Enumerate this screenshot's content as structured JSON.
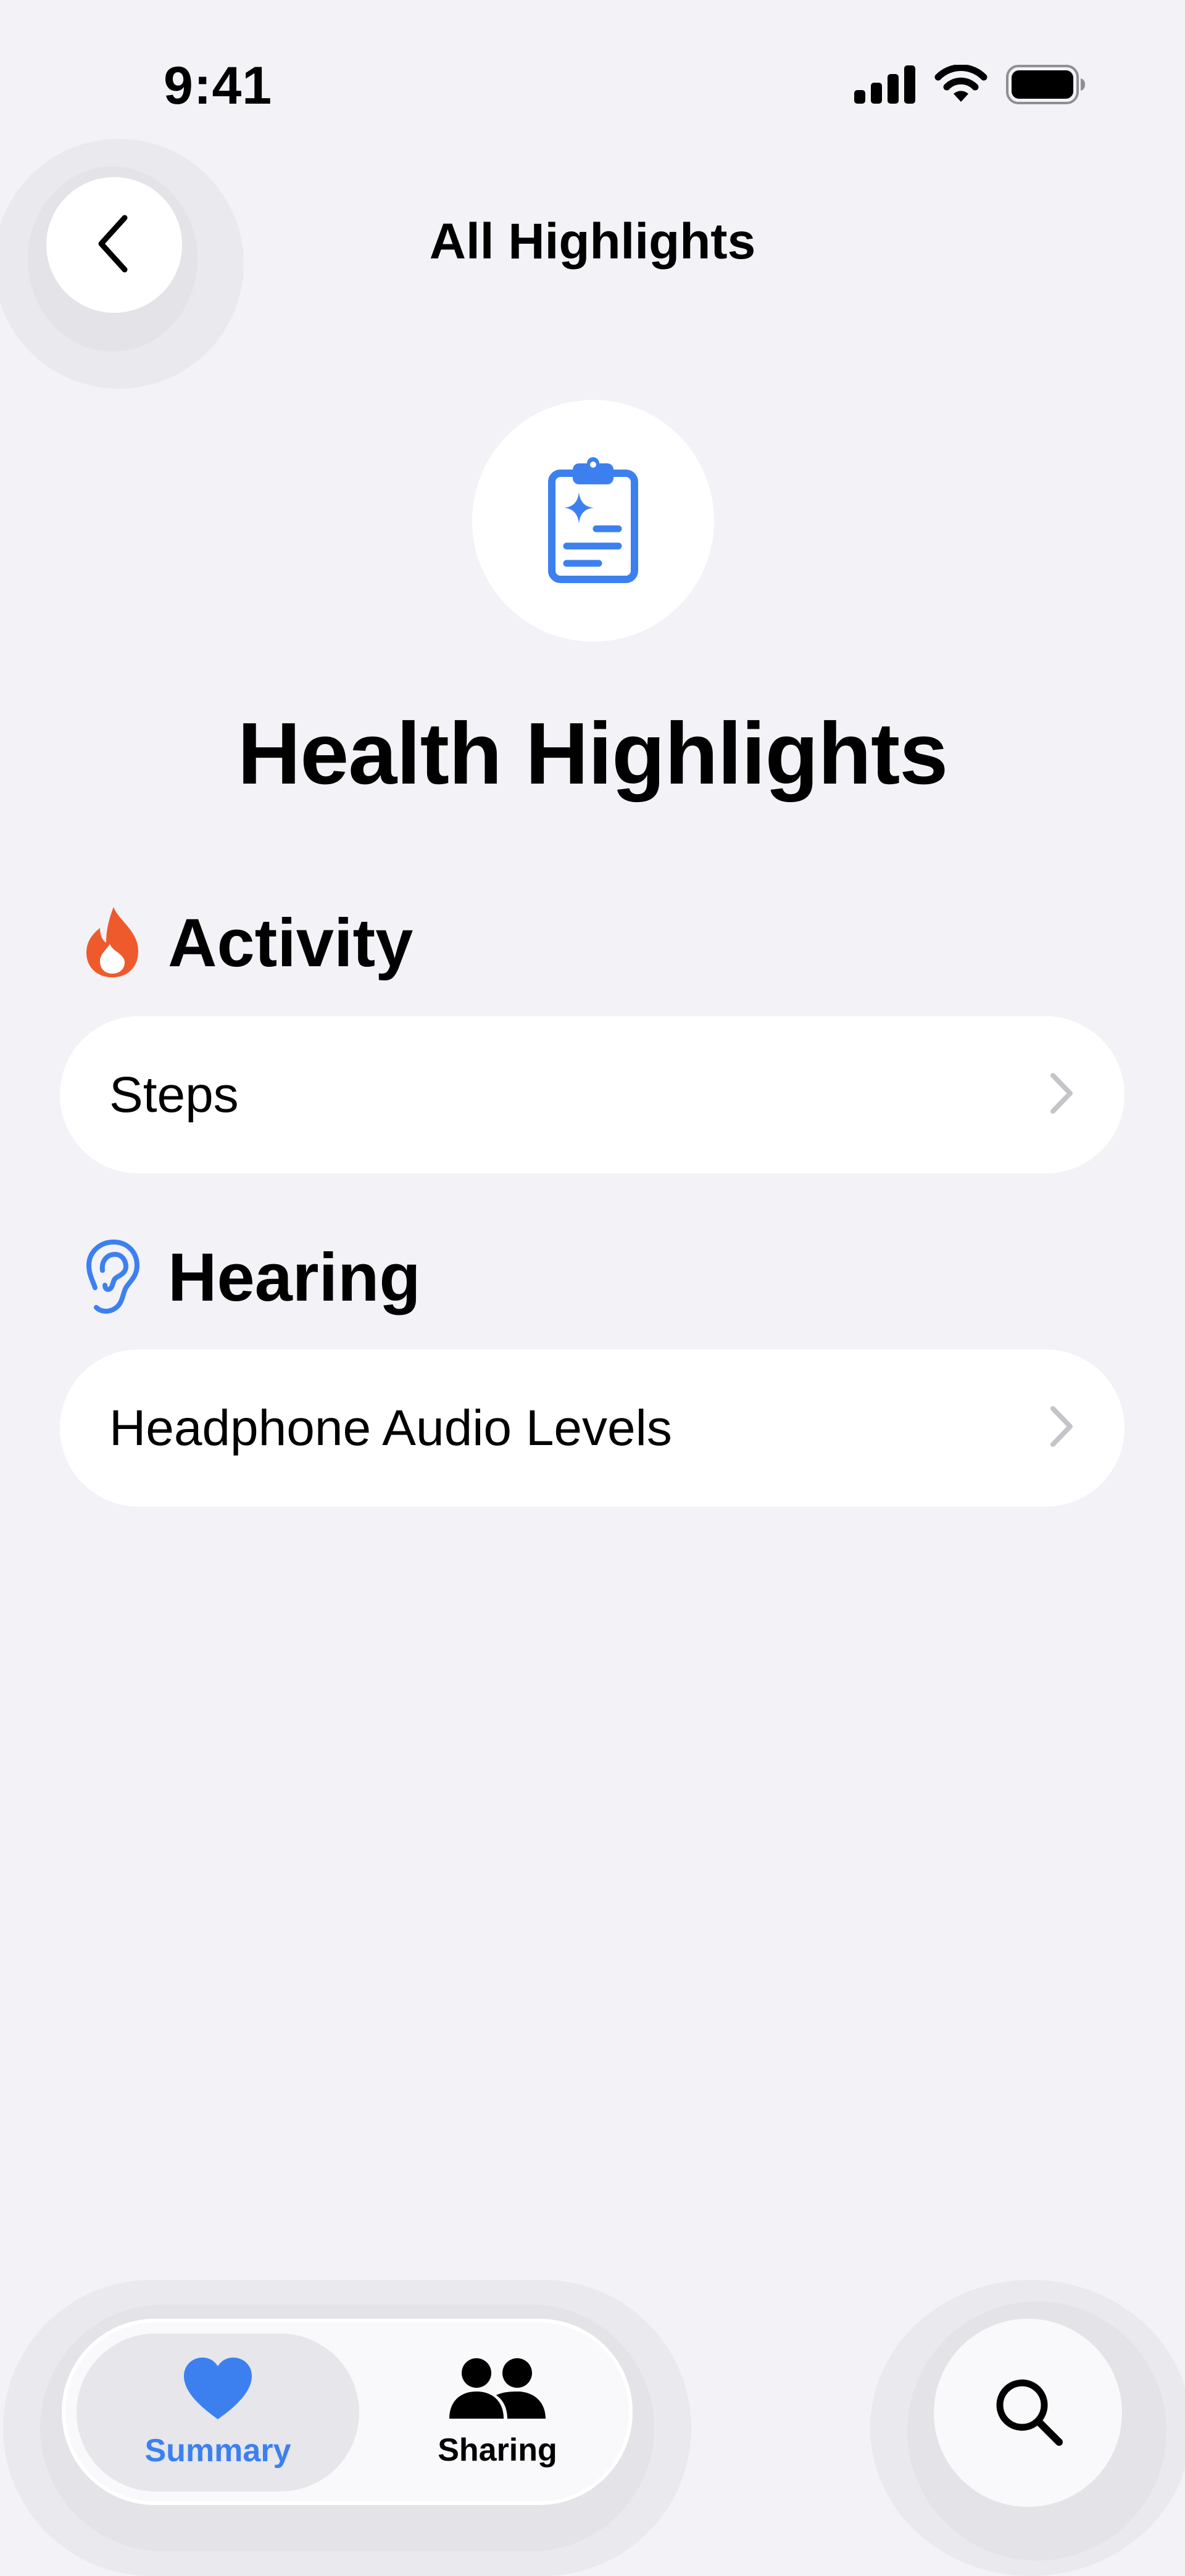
{
  "status_bar": {
    "time": "9:41",
    "icons": [
      "cellular-signal-icon",
      "wifi-icon",
      "battery-icon"
    ]
  },
  "nav": {
    "title": "All Highlights",
    "back_icon": "chevron-left-icon"
  },
  "hero": {
    "icon": "clipboard-sparkle-icon",
    "title": "Health Highlights"
  },
  "sections": [
    {
      "title": "Activity",
      "icon": "flame-icon",
      "rows": [
        {
          "label": "Steps"
        }
      ]
    },
    {
      "title": "Hearing",
      "icon": "ear-icon",
      "rows": [
        {
          "label": "Headphone Audio Levels"
        }
      ]
    }
  ],
  "tab_bar": {
    "tabs": [
      {
        "label": "Summary",
        "icon": "heart-icon",
        "selected": true
      },
      {
        "label": "Sharing",
        "icon": "people-icon",
        "selected": false
      }
    ],
    "search_icon": "search-icon"
  },
  "colors": {
    "background": "#f2f2f7",
    "accent_blue": "#3c80f0",
    "activity_orange": "#ef5a2c",
    "chevron_gray": "#c4c4c9"
  }
}
